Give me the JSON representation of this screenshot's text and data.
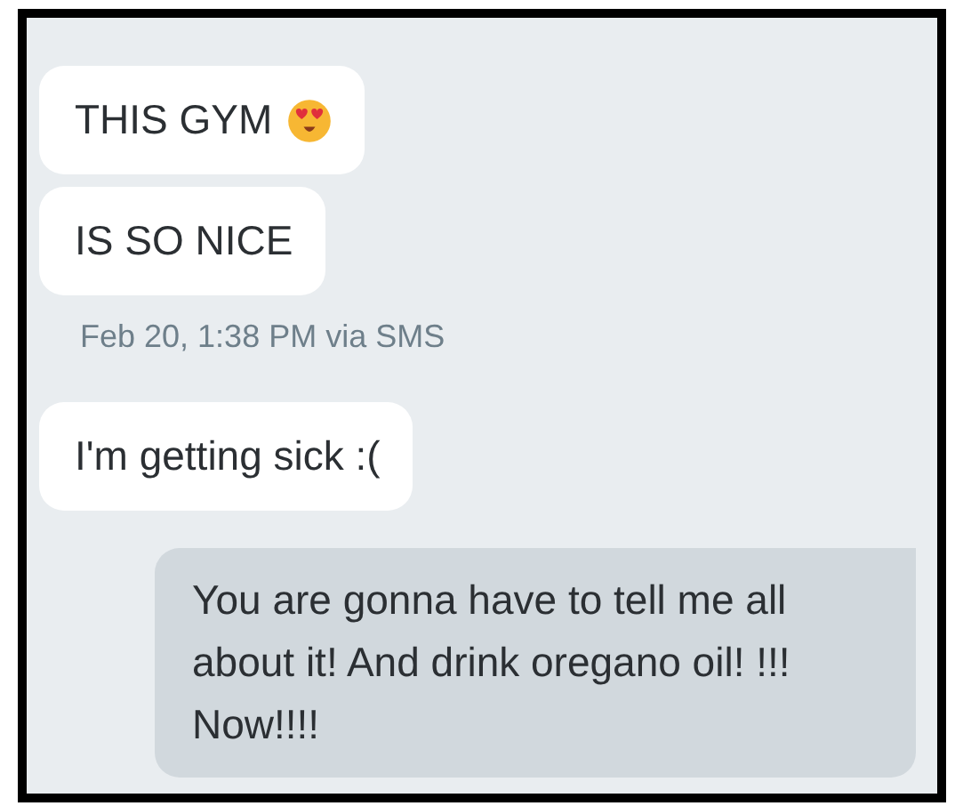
{
  "messages": [
    {
      "kind": "emoji",
      "text": "THIS GYM"
    },
    {
      "kind": "incoming",
      "text": "IS SO NICE"
    },
    {
      "kind": "timestamp",
      "text": "Feb 20, 1:38 PM via SMS"
    },
    {
      "kind": "incoming",
      "text": "I'm getting sick :("
    },
    {
      "kind": "outgoing",
      "text": "You are gonna have to tell me all about it! And drink oregano oil! !!! Now!!!!"
    }
  ]
}
